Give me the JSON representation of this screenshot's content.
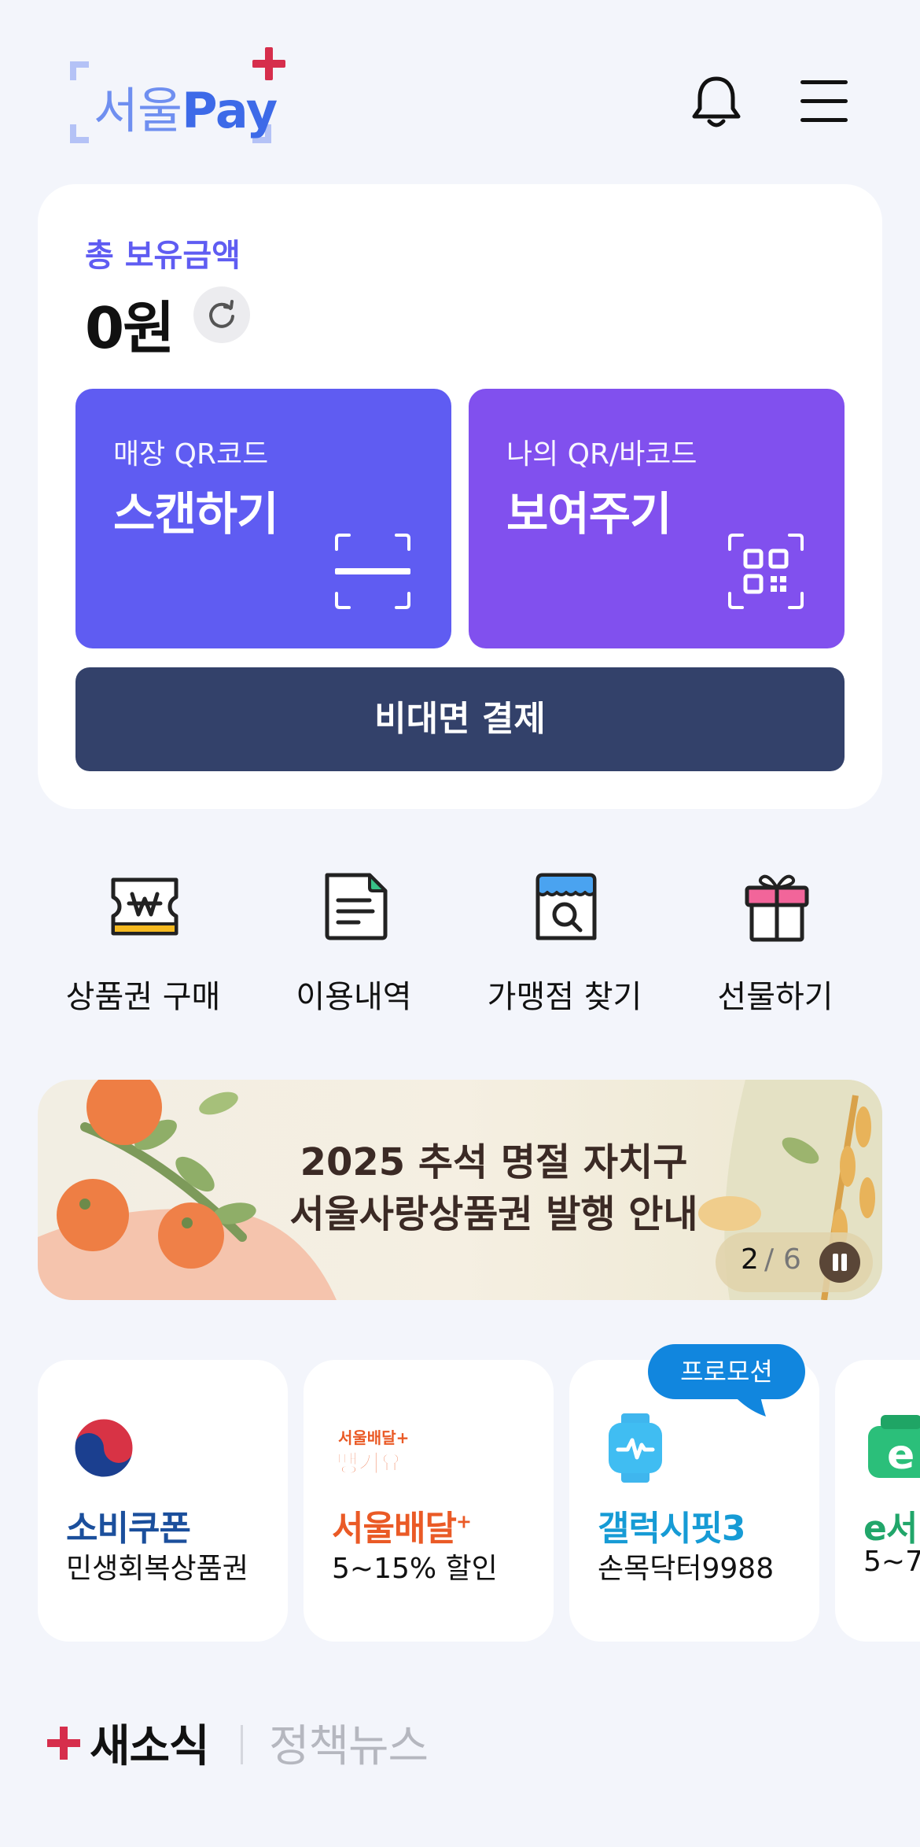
{
  "header": {
    "logo_korean": "서울",
    "logo_pay": "Pay"
  },
  "balance": {
    "label": "총 보유금액",
    "amount": "0원"
  },
  "qr": {
    "scan": {
      "sub": "매장 QR코드",
      "main": "스캔하기"
    },
    "show": {
      "sub": "나의 QR/바코드",
      "main": "보여주기"
    }
  },
  "contactless": {
    "label": "비대면 결제"
  },
  "quick_menu": [
    {
      "label": "상품권 구매",
      "icon": "voucher-icon"
    },
    {
      "label": "이용내역",
      "icon": "document-icon"
    },
    {
      "label": "가맹점 찾기",
      "icon": "store-search-icon"
    },
    {
      "label": "선물하기",
      "icon": "gift-icon"
    }
  ],
  "banner": {
    "line1": "2025 추석 명절 자치구",
    "line2": "서울사랑상품권 발행 안내",
    "current": "2",
    "separator": "/",
    "total": "6"
  },
  "promos": [
    {
      "title": "소비쿠폰",
      "desc": "민생회복상품권",
      "color": "#1b4f9c"
    },
    {
      "title": "서울배달",
      "title_sup": "+",
      "desc": "5~15% 할인",
      "color": "#ea5a26",
      "logo_text_top": "서울배달+",
      "logo_text_bottom": "땡겨요"
    },
    {
      "title": "갤럭시핏3",
      "desc": "손목닥터9988",
      "color": "#169bd5"
    },
    {
      "title": "e서",
      "desc": "5~7",
      "color": "#21a66a",
      "logo_text": "e"
    }
  ],
  "promo_badge": "프로모션",
  "news": {
    "tab_new": "새소식",
    "tab_policy": "정책뉴스"
  },
  "colors": {
    "background": "#f3f5fb",
    "primary": "#5f5cf2",
    "secondary": "#8150ee",
    "navy": "#33416a",
    "brand_red": "#d62e4c"
  }
}
